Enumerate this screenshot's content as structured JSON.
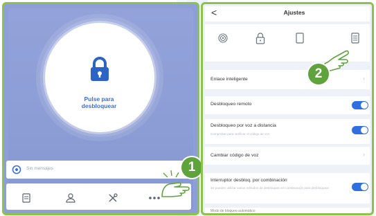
{
  "left_screen": {
    "unlock_label": "Pulse para desbloquear",
    "message_placeholder": "Sin mensajes"
  },
  "right_screen": {
    "back_glyph": "<",
    "title": "Ajustes",
    "settings": [
      {
        "title": "Enlace inteligente",
        "type": "chevron"
      },
      {
        "title": "Desbloqueo remoto",
        "type": "toggle",
        "on": true
      },
      {
        "title": "Desbloqueo por voz a distancia",
        "subtitle": "Comprobar para verificar el código de voz",
        "type": "toggle",
        "on": true
      },
      {
        "title": "Cambiar código de voz",
        "type": "chevron"
      },
      {
        "title": "Interruptor desbloq. por combinación",
        "subtitle": "Se pueden utilizar varios métodos de desbloqueo en combinación para desbloquear",
        "type": "toggle",
        "on": true
      },
      {
        "title": "Modo de bloqueo automático",
        "type": "chevron"
      }
    ]
  },
  "badges": {
    "one": "1",
    "two": "2"
  },
  "colors": {
    "accent_blue": "#2f6fe0",
    "frame_green": "#8bc34a",
    "badge_green": "#5fa33c"
  }
}
